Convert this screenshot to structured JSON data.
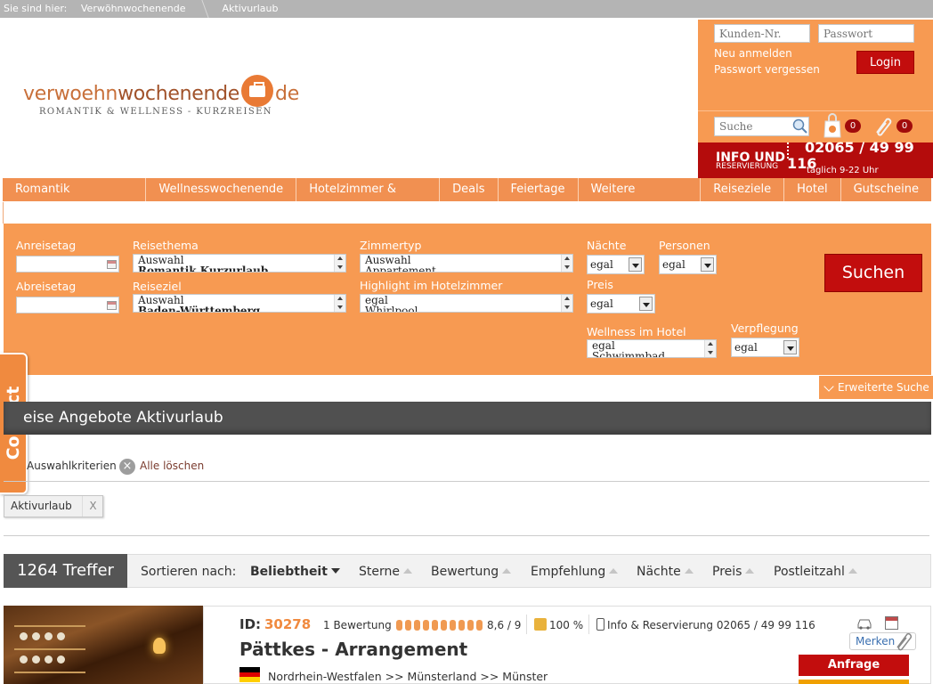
{
  "breadcrumb": {
    "prefix": "Sie sind hier:",
    "items": [
      "Verwöhnwochenende",
      "Aktivurlaub"
    ]
  },
  "logo": {
    "part1": "verwoehn",
    "part2": "wochenende",
    "part3": "de",
    "tagline": "ROMANTIK & WELLNESS - KURZREISEN"
  },
  "login": {
    "customer_placeholder": "Kunden-Nr.",
    "password_placeholder": "Passwort",
    "register": "Neu anmelden",
    "forgot": "Passwort vergessen",
    "login_button": "Login"
  },
  "header_search": {
    "placeholder": "Suche",
    "bag_count": "0",
    "clip_count": "0"
  },
  "info": {
    "title": "INFO UND",
    "subtitle": "RESERVIERUNG",
    "phone": "02065 / 49 99 116",
    "hours": "täglich 9-22 Uhr"
  },
  "nav": [
    "Romantik Kurzurlaub",
    "Wellnesswochenende",
    "Hotelzimmer & Suite",
    "Deals",
    "Feiertage",
    "Weitere Kurztrips",
    "Reiseziele",
    "Hotel",
    "Gutscheine"
  ],
  "search": {
    "arrival_label": "Anreisetag",
    "departure_label": "Abreisetag",
    "theme_label": "Reisethema",
    "theme_options": [
      "Auswahl",
      "Romantik Kurzurlaub"
    ],
    "destination_label": "Reiseziel",
    "destination_options": [
      "Auswahl",
      "Baden-Württemberg"
    ],
    "room_label": "Zimmertyp",
    "room_options": [
      "Auswahl",
      "Appartement"
    ],
    "highlight_label": "Highlight im Hotelzimmer",
    "highlight_options": [
      "egal",
      "Whirlpool"
    ],
    "nights_label": "Nächte",
    "nights_value": "egal",
    "persons_label": "Personen",
    "persons_value": "egal",
    "price_label": "Preis",
    "price_value": "egal",
    "wellness_label": "Wellness im Hotel",
    "wellness_options": [
      "egal",
      "Schwimmbad"
    ],
    "board_label": "Verpflegung",
    "board_value": "egal",
    "submit": "Suchen",
    "extended": "Erweiterte Suche"
  },
  "contact": "Contact",
  "results_heading": "eise Angebote Aktivurlaub",
  "filters": {
    "label": "Auswahlkriterien",
    "clear": "Alle löschen",
    "clear_icon": "×",
    "chips": [
      {
        "label": "Aktivurlaub",
        "remove": "X"
      }
    ]
  },
  "sort": {
    "count": "1264 Treffer",
    "label": "Sortieren nach:",
    "options": [
      "Beliebtheit",
      "Sterne",
      "Bewertung",
      "Empfehlung",
      "Nächte",
      "Preis",
      "Postleitzahl"
    ],
    "active": "Beliebtheit"
  },
  "listing": {
    "id_label": "ID:",
    "id": "30278",
    "reviews": "1 Bewertung",
    "rating": 8.6,
    "rating_max": 9,
    "rating_text": "8,6 / 9",
    "recommend": "100 %",
    "info_phone": "Info & Reservierung 02065 / 49 99 116",
    "title": "Pättkes - Arrangement",
    "location": "Nordrhein-Westfalen >> Münsterland >> Münster",
    "bookmark": "Merken",
    "request": "Anfrage",
    "flag_colors": [
      "#000000",
      "#dd0000",
      "#ffce00"
    ]
  },
  "colors": {
    "orange": "#f79a52",
    "red": "#c20d0d",
    "dark": "#505050"
  }
}
